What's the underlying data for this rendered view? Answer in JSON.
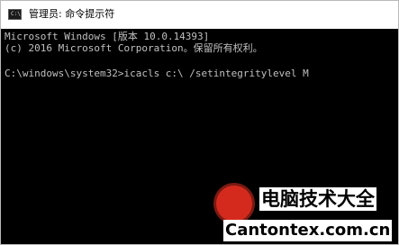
{
  "window": {
    "title": "管理员: 命令提示符",
    "icon": "cmd-icon",
    "icon_glyph": "C:\\"
  },
  "console": {
    "lines": [
      "Microsoft Windows [版本 10.0.14393]",
      "(c) 2016 Microsoft Corporation。保留所有权利。",
      "C:\\windows\\system32>icacls c:\\ /setintegritylevel M"
    ]
  },
  "watermark": {
    "chinese_text": "电脑技术大全",
    "site_text": "Cantontex.com.cn"
  },
  "colors": {
    "console_background": "#000000",
    "console_text": "#c0c0c0",
    "titlebar_background": "#ffffff",
    "watermark_badge": "#d42a1e"
  }
}
